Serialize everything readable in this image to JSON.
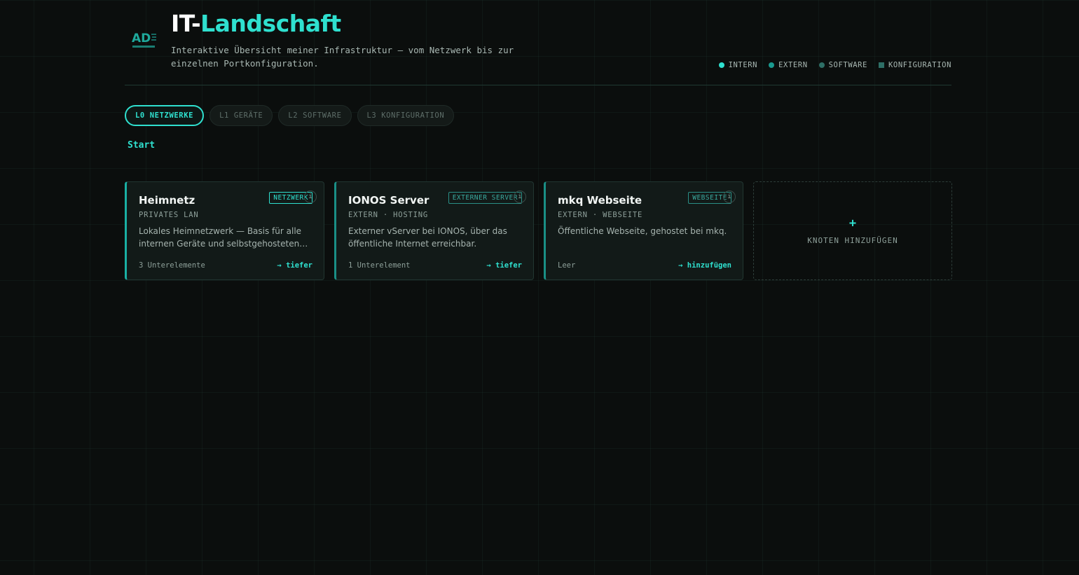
{
  "header": {
    "logo_text": "AD",
    "title_prefix": "IT-",
    "title_accent": "Landschaft",
    "subtitle": "Interaktive Übersicht meiner Infrastruktur — vom Netzwerk bis zur einzelnen Portkonfiguration."
  },
  "legend": [
    {
      "label": "INTERN",
      "color": "#2fe0cf",
      "shape": "dot"
    },
    {
      "label": "EXTERN",
      "color": "#1a9a8f",
      "shape": "dot"
    },
    {
      "label": "SOFTWARE",
      "color": "#2e6f66",
      "shape": "dot"
    },
    {
      "label": "KONFIGURATION",
      "color": "#2e6f66",
      "shape": "square"
    }
  ],
  "tabs": [
    {
      "label": "L0 NETZWERKE",
      "active": true
    },
    {
      "label": "L1 GERÄTE",
      "active": false
    },
    {
      "label": "L2 SOFTWARE",
      "active": false
    },
    {
      "label": "L3 KONFIGURATION",
      "active": false
    }
  ],
  "breadcrumb": "Start",
  "cards": [
    {
      "title": "Heimnetz",
      "badge": "NETZWERK",
      "meta": "PRIVATES LAN",
      "desc": "Lokales Heimnetzwerk — Basis für alle internen Geräte und selbstgehosteten…",
      "count": "3 Unterelemente",
      "action": "→ tiefer"
    },
    {
      "title": "IONOS Server",
      "badge": "EXTERNER SERVER",
      "meta": "EXTERN · HOSTING",
      "desc": "Externer vServer bei IONOS, über das öffentliche Internet erreichbar.",
      "count": "1 Unterelement",
      "action": "→ tiefer"
    },
    {
      "title": "mkq Webseite",
      "badge": "WEBSEITE",
      "meta": "EXTERN · WEBSEITE",
      "desc": "Öffentliche Webseite, gehostet bei mkq.",
      "count": "Leer",
      "action": "→ hinzufügen"
    }
  ],
  "add_card": {
    "plus": "+",
    "label": "KNOTEN HINZUFÜGEN"
  },
  "colors": {
    "accent": "#2fe0cf",
    "background": "#0b0e0d"
  }
}
